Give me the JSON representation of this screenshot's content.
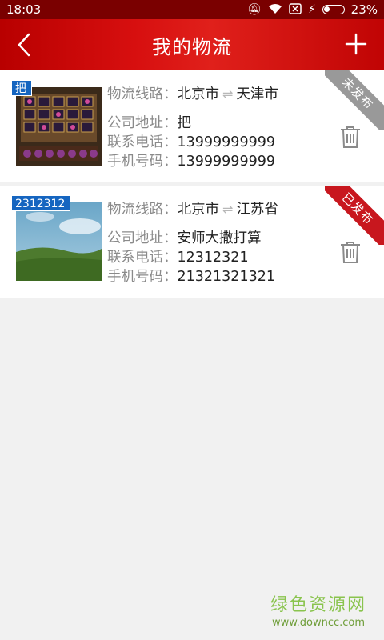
{
  "status_bar": {
    "time": "18:03",
    "battery": "23%"
  },
  "header": {
    "title": "我的物流",
    "back_icon": "back-chevron-icon",
    "add_icon": "plus-icon"
  },
  "labels": {
    "route": "物流线路：",
    "address": "公司地址：",
    "phone": "联系电话：",
    "mobile": "手机号码："
  },
  "cards": [
    {
      "tag": "把",
      "from": "北京市",
      "to": "天津市",
      "address": "把",
      "phone": "13999999999",
      "mobile": "13999999999",
      "status": "未发布",
      "status_color": "#999999"
    },
    {
      "tag": "2312312",
      "from": "北京市",
      "to": "江苏省",
      "address": "安师大撒打算",
      "phone": "12312321",
      "mobile": "21321321321",
      "status": "已发布",
      "status_color": "#c8171e"
    }
  ],
  "watermark": {
    "cn": "绿色资源网",
    "en": "www.downcc.com"
  }
}
